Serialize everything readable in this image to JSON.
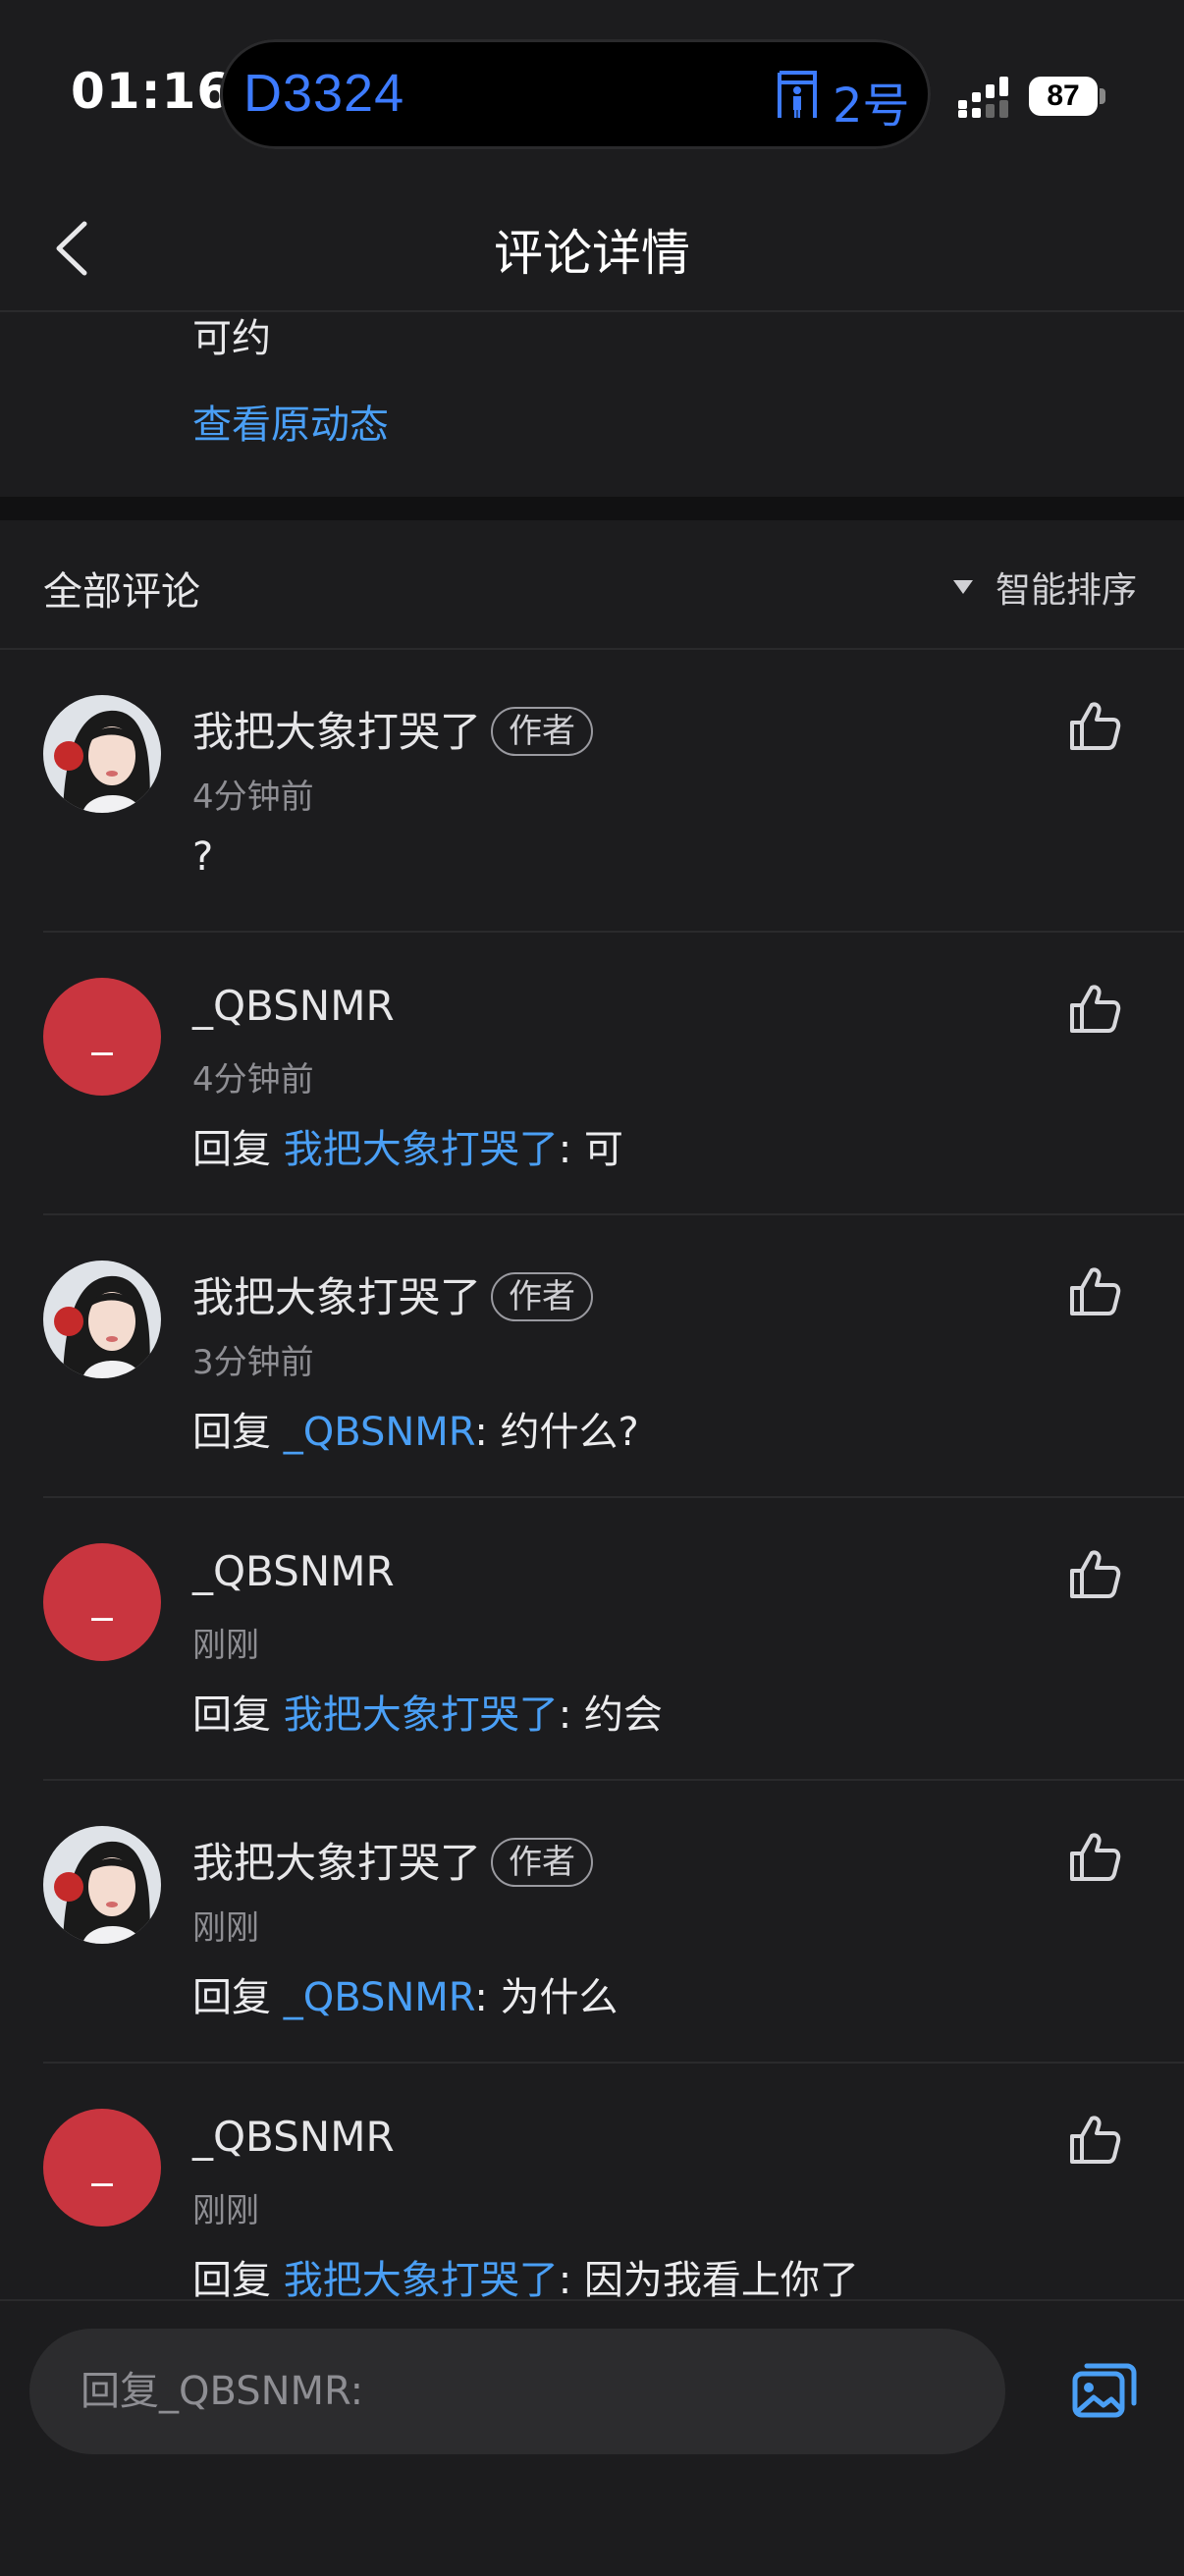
{
  "status_bar": {
    "time": "01:16",
    "train": "D3324",
    "coach": "2号",
    "battery": "87"
  },
  "header": {
    "title": "评论详情"
  },
  "post": {
    "text": "可约",
    "view_original": "查看原动态"
  },
  "comments_section": {
    "label": "全部评论",
    "sort_label": "智能排序"
  },
  "comments": [
    {
      "username": "我把大象打哭了",
      "badge": "作者",
      "time": "4分钟前",
      "text": "?",
      "avatar": "photo"
    },
    {
      "username": "_QBSNMR",
      "time": "4分钟前",
      "reply_prefix": "回复 ",
      "mention": "我把大象打哭了",
      "text": ": 可",
      "avatar": "red",
      "avatar_text": "_"
    },
    {
      "username": "我把大象打哭了",
      "badge": "作者",
      "time": "3分钟前",
      "reply_prefix": "回复 ",
      "mention": "_QBSNMR",
      "text": ": 约什么?",
      "avatar": "photo"
    },
    {
      "username": "_QBSNMR",
      "time": "刚刚",
      "reply_prefix": "回复 ",
      "mention": "我把大象打哭了",
      "text": ": 约会",
      "avatar": "red",
      "avatar_text": "_"
    },
    {
      "username": "我把大象打哭了",
      "badge": "作者",
      "time": "刚刚",
      "reply_prefix": "回复 ",
      "mention": "_QBSNMR",
      "text": ": 为什么",
      "avatar": "photo"
    },
    {
      "username": "_QBSNMR",
      "time": "刚刚",
      "reply_prefix": "回复 ",
      "mention": "我把大象打哭了",
      "text": ": 因为我看上你了",
      "avatar": "red",
      "avatar_text": "_"
    }
  ],
  "reply_bar": {
    "placeholder": "回复_QBSNMR:"
  },
  "colors": {
    "background": "#1c1c1e",
    "link": "#4a9ff5",
    "avatar_red": "#c9353f",
    "island_text": "#3d7bff"
  },
  "icons": [
    "back-icon",
    "sort-triangle-icon",
    "like-icon",
    "image-icon",
    "signal-icon",
    "coach-icon"
  ]
}
